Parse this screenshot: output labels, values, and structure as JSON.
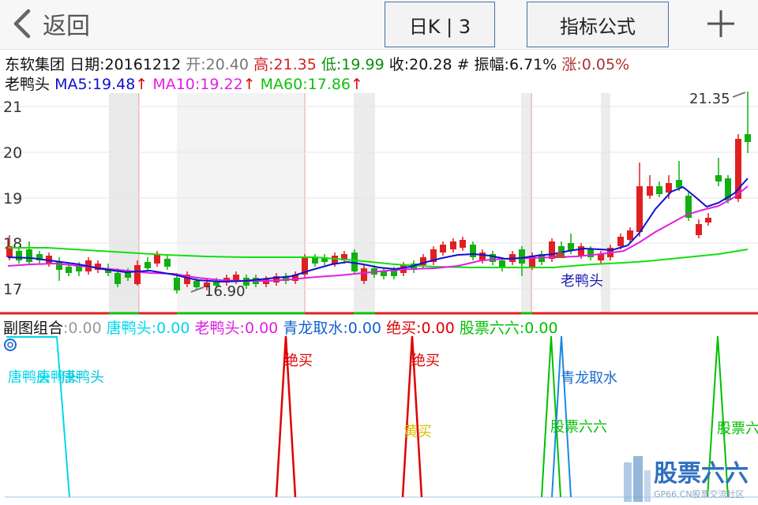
{
  "header": {
    "back_label": "返回",
    "period_button": "日K | 3",
    "formula_button": "指标公式"
  },
  "info": {
    "stock": "东软集团",
    "date": "日期:20161212",
    "open": "开:20.40",
    "high": "高:21.35",
    "low": "低:19.99",
    "close": "收:20.28",
    "amp": "# 振幅:6.71%",
    "change": "涨:0.05%"
  },
  "ma": {
    "name": "老鸭头",
    "ma5": "MA5:19.48",
    "ma10": "MA10:19.22",
    "ma60": "MA60:17.86",
    "arrow": "↑"
  },
  "price_axis": [
    "21",
    "20",
    "19",
    "18",
    "17"
  ],
  "annotations": {
    "high_label": "21.35",
    "low_label": "16.90",
    "pattern_label": "老鸭头"
  },
  "sub_chart": {
    "title": "副图组合",
    "items": [
      {
        "text": ":0.00",
        "color": "#999999"
      },
      {
        "text": "唐鸭头:0.00",
        "color": "#00d8ec"
      },
      {
        "text": "老鸭头:0.00",
        "color": "#e020e0"
      },
      {
        "text": "青龙取水:0.00",
        "color": "#1560d0"
      },
      {
        "text": "绝买:0.00",
        "color": "#e00000"
      },
      {
        "text": "股票六六:0.00",
        "color": "#00c000"
      }
    ],
    "signal_labels": {
      "tang": "唐鸭头",
      "juemai1": "绝买",
      "juemai2": "绝买",
      "huangmai": "黄买",
      "qinglong": "青龙取水",
      "gupiao1": "股票六六",
      "gupiao2": "股票六"
    }
  },
  "watermark": {
    "brand": "股票六六",
    "url": "GP66.CN股票交流社区"
  },
  "colors": {
    "up": "#e02020",
    "down": "#10b010",
    "ma5": "#1010d0",
    "ma10": "#e020e0",
    "ma60": "#10e010",
    "divider_red": "#e02020",
    "divider_green": "#10c010"
  }
}
